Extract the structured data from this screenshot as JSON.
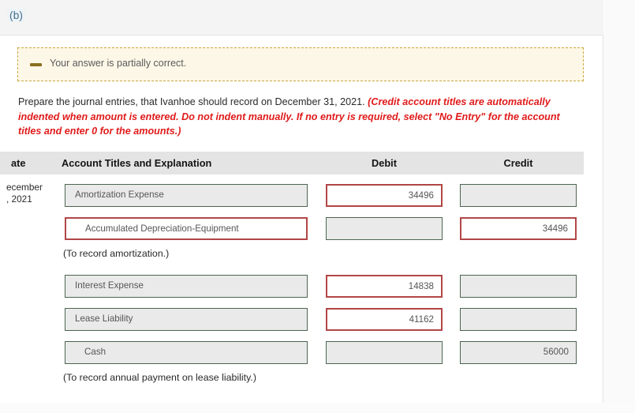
{
  "top_bar": {
    "part_label": "(b)"
  },
  "alert": {
    "icon": "minus-icon",
    "message": "Your answer is partially correct."
  },
  "instructions": {
    "lead": "Prepare the journal entries, that Ivanhoe should record on December 31, 2021. ",
    "note": "(Credit account titles are automatically indented when amount is entered. Do not indent manually. If no entry is required, select \"No Entry\" for the account titles and enter 0 for the amounts.)"
  },
  "table": {
    "headers": {
      "date": "ate",
      "account": "Account Titles and Explanation",
      "debit": "Debit",
      "credit": "Credit"
    },
    "rows": [
      {
        "kind": "entry",
        "date_line1": "ecember",
        "date_line2": ", 2021",
        "account": "Amortization Expense",
        "account_indent": false,
        "account_error": false,
        "debit": "34496",
        "debit_error": true,
        "credit": "",
        "credit_error": false
      },
      {
        "kind": "entry",
        "date_line1": "",
        "date_line2": "",
        "account": "Accumulated Depreciation-Equipment",
        "account_indent": true,
        "account_error": true,
        "debit": "",
        "debit_error": false,
        "credit": "34496",
        "credit_error": true
      },
      {
        "kind": "memo",
        "memo": "(To record amortization.)"
      },
      {
        "kind": "entry",
        "date_line1": "",
        "date_line2": "",
        "account": "Interest Expense",
        "account_indent": false,
        "account_error": false,
        "debit": "14838",
        "debit_error": true,
        "credit": "",
        "credit_error": false
      },
      {
        "kind": "entry",
        "date_line1": "",
        "date_line2": "",
        "account": "Lease Liability",
        "account_indent": false,
        "account_error": false,
        "debit": "41162",
        "debit_error": true,
        "credit": "",
        "credit_error": false
      },
      {
        "kind": "entry",
        "date_line1": "",
        "date_line2": "",
        "account": "Cash",
        "account_indent": true,
        "account_error": false,
        "debit": "",
        "debit_error": false,
        "credit": "56000",
        "credit_error": false
      },
      {
        "kind": "memo",
        "memo": "(To record annual payment on lease liability.)"
      }
    ]
  },
  "colors": {
    "error_border": "#b24646",
    "ok_border": "#4d6551",
    "field_fill": "#eaeaea",
    "alert_bg": "#fdf7e7",
    "alert_border": "#c9a93f",
    "note_red": "#e01a1a",
    "part_label_blue": "#3d6e8f"
  }
}
